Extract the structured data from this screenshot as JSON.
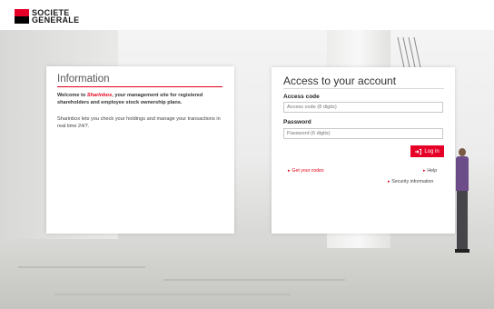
{
  "header": {
    "logo_line1": "SOCIETE",
    "logo_line2": "GENERALE"
  },
  "information": {
    "title": "Information",
    "welcome_prefix": "Welcome to ",
    "brand": "Sharinbox",
    "welcome_suffix": ", your management site for registered shareholders and employee stock ownership plans.",
    "description": "Sharinbox lets you check your holdings and manage your transactions in real time 24/7."
  },
  "access": {
    "title": "Access to your account",
    "access_code_label": "Access code",
    "access_code_placeholder": "Access code (8 digits)",
    "access_code_value": "",
    "password_label": "Password",
    "password_placeholder": "Password (6 digits)",
    "password_value": "",
    "login_label": "Log in",
    "get_codes_label": "Get your codes",
    "help_label": "Help",
    "security_label": "Security information"
  },
  "colors": {
    "brand_red": "#e60028",
    "brand_black": "#000000"
  },
  "icons": {
    "login": "log-in-icon",
    "link_arrow": "caret-right-icon"
  }
}
